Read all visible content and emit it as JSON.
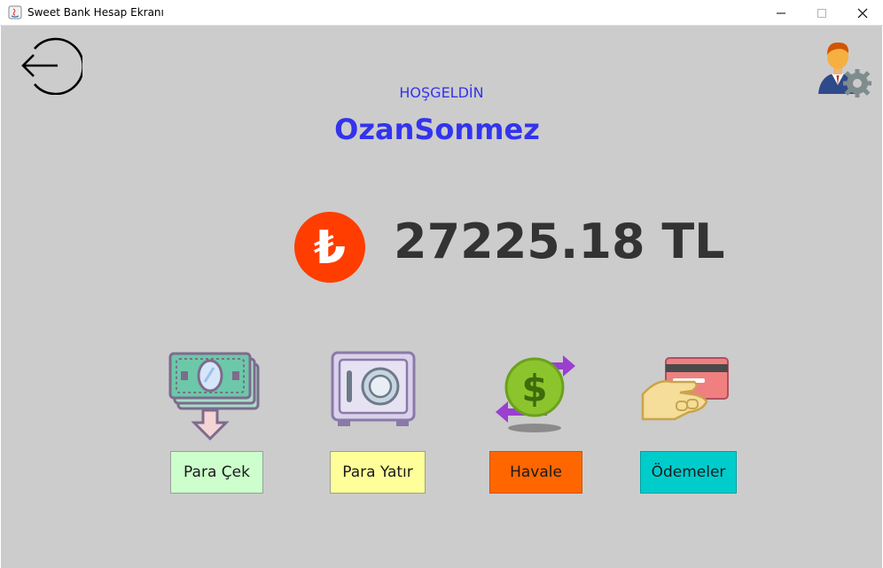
{
  "window": {
    "title": "Sweet Bank Hesap Ekranı"
  },
  "header": {
    "welcome_text": "HOŞGELDİN",
    "username": "OzanSonmez"
  },
  "account": {
    "balance": "27225.18 TL",
    "currency_symbol": "₺"
  },
  "actions": {
    "withdraw_label": "Para Çek",
    "deposit_label": "Para Yatır",
    "transfer_label": "Havale",
    "payments_label": "Ödemeler"
  },
  "icons": {
    "back": "logout-arrow-icon",
    "profile": "user-settings-icon",
    "currency": "turkish-lira-icon",
    "withdraw": "cash-withdraw-icon",
    "deposit": "safe-icon",
    "transfer": "money-transfer-icon",
    "payments": "card-payment-icon"
  },
  "colors": {
    "background": "#cccccc",
    "accent_text": "#3333ee",
    "balance_text": "#333333",
    "lira_circle": "#ff3d00",
    "withdraw_btn": "#ccffcc",
    "deposit_btn": "#ffff99",
    "transfer_btn": "#ff6600",
    "payments_btn": "#00cccc"
  }
}
